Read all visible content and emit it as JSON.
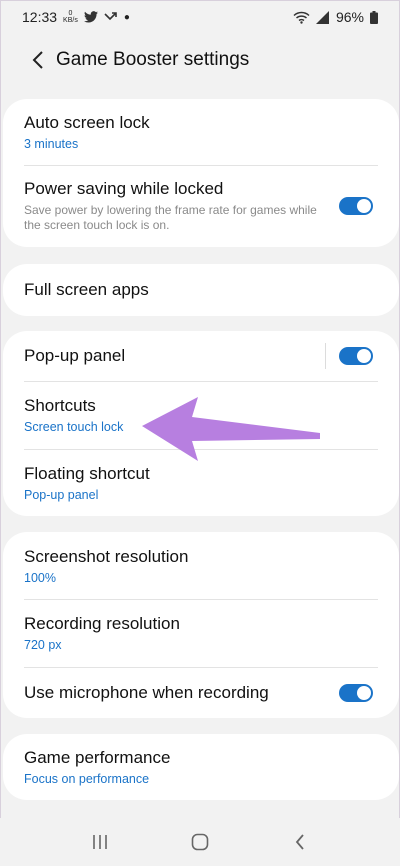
{
  "status_bar": {
    "time": "12:33",
    "kbs_value": "0",
    "kbs_unit": "KB/s",
    "battery": "96%",
    "icons": [
      "twitter-icon",
      "missed-call-icon",
      "wifi-icon",
      "signal-icon",
      "battery-icon"
    ]
  },
  "header": {
    "title": "Game Booster settings"
  },
  "cards": {
    "lock": {
      "auto_screen_lock": {
        "title": "Auto screen lock",
        "value": "3 minutes"
      },
      "power_saving": {
        "title": "Power saving while locked",
        "description": "Save power by lowering the frame rate for games while the screen touch lock is on.",
        "enabled": true
      }
    },
    "full_screen": {
      "title": "Full screen apps"
    },
    "panel": {
      "popup_panel": {
        "title": "Pop-up panel",
        "enabled": true
      },
      "shortcuts": {
        "title": "Shortcuts",
        "value": "Screen touch lock"
      },
      "floating_shortcut": {
        "title": "Floating shortcut",
        "value": "Pop-up panel"
      }
    },
    "recording": {
      "screenshot_resolution": {
        "title": "Screenshot resolution",
        "value": "100%"
      },
      "recording_resolution": {
        "title": "Recording resolution",
        "value": "720 px"
      },
      "microphone": {
        "title": "Use microphone when recording",
        "enabled": true
      }
    },
    "performance": {
      "game_performance": {
        "title": "Game performance",
        "value": "Focus on performance"
      }
    }
  },
  "colors": {
    "accent": "#1a73c8",
    "background": "#f2f2f2",
    "card": "#ffffff",
    "annotation_arrow": "#b77fe0"
  }
}
